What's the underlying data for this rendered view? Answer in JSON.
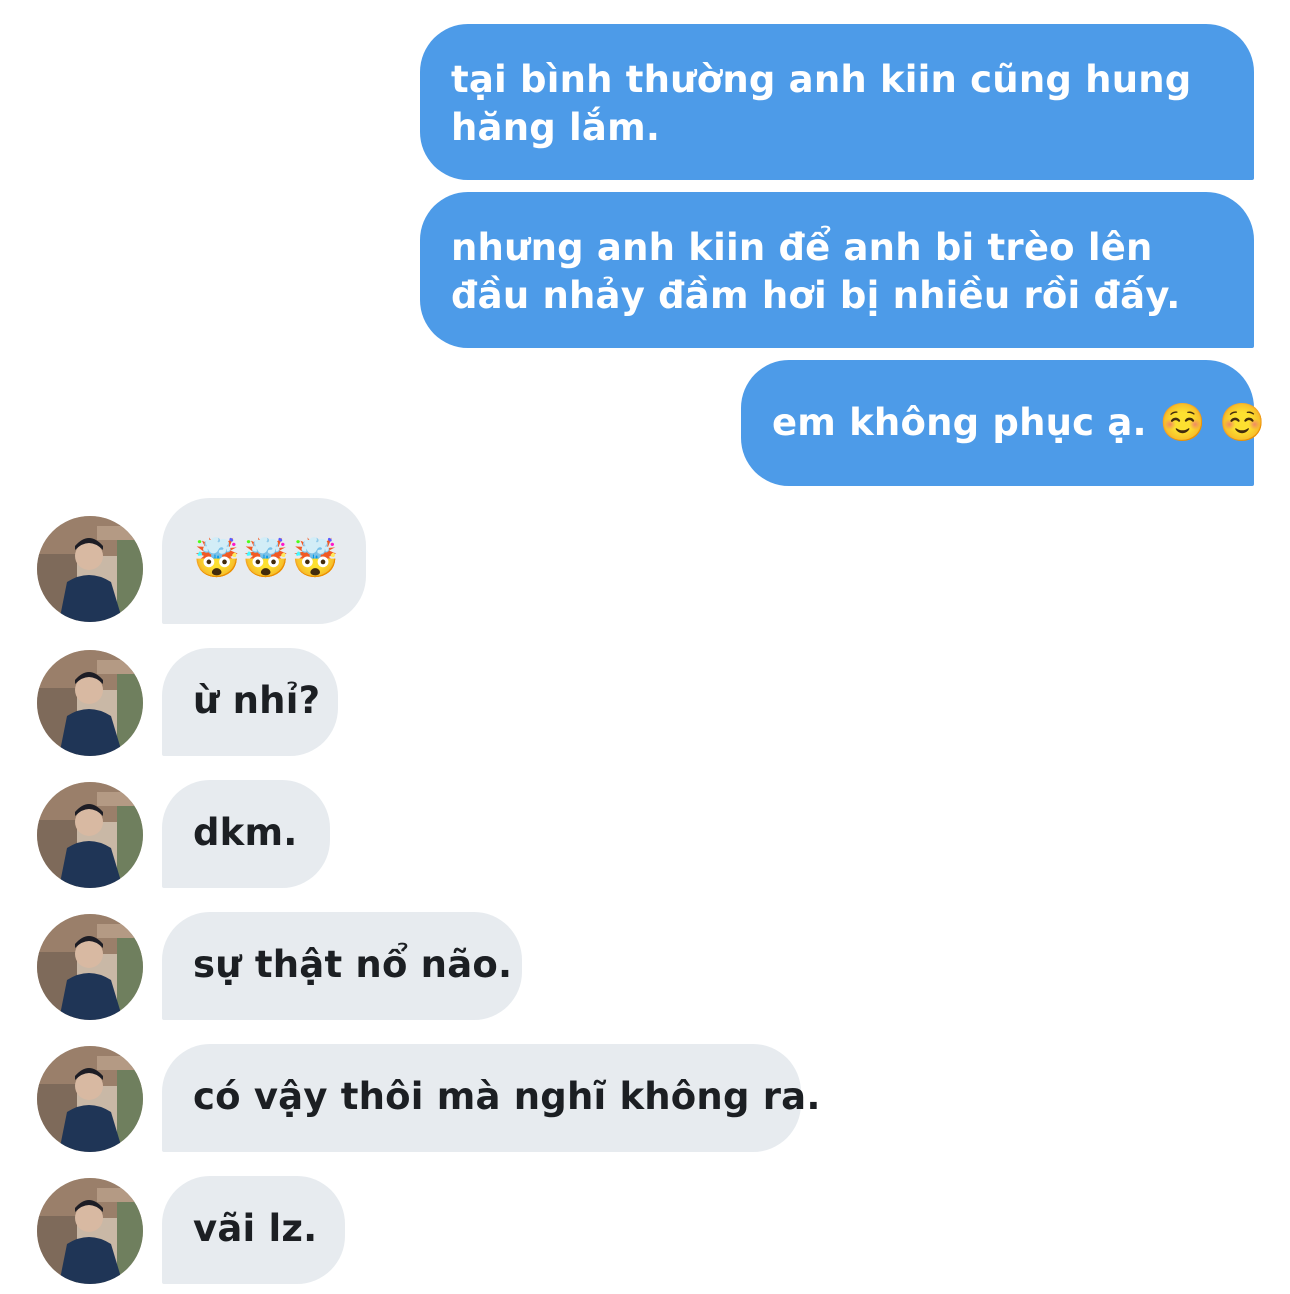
{
  "outgoing": [
    {
      "text": "tại bình thường anh kiin cũng hung hăng lắm."
    },
    {
      "text": "nhưng anh kiin để anh bi trèo lên đầu nhảy đầm hơi bị nhiều rồi đấy."
    },
    {
      "text": "em không phục ạ. ☺️ ☺️"
    }
  ],
  "incoming": [
    {
      "text": "🤯🤯🤯",
      "emoji_only": true
    },
    {
      "text": "ừ nhỉ?"
    },
    {
      "text": "dkm."
    },
    {
      "text": "sự thật nổ não."
    },
    {
      "text": "có vậy thôi mà nghĩ không ra."
    },
    {
      "text": "vãi lz."
    }
  ],
  "colors": {
    "outgoing_bubble": "#4d9be8",
    "incoming_bubble": "#e7ebef",
    "outgoing_text": "#ffffff",
    "incoming_text": "#1c1f23"
  },
  "avatar": {
    "icon": "contact-photo-avatar"
  }
}
